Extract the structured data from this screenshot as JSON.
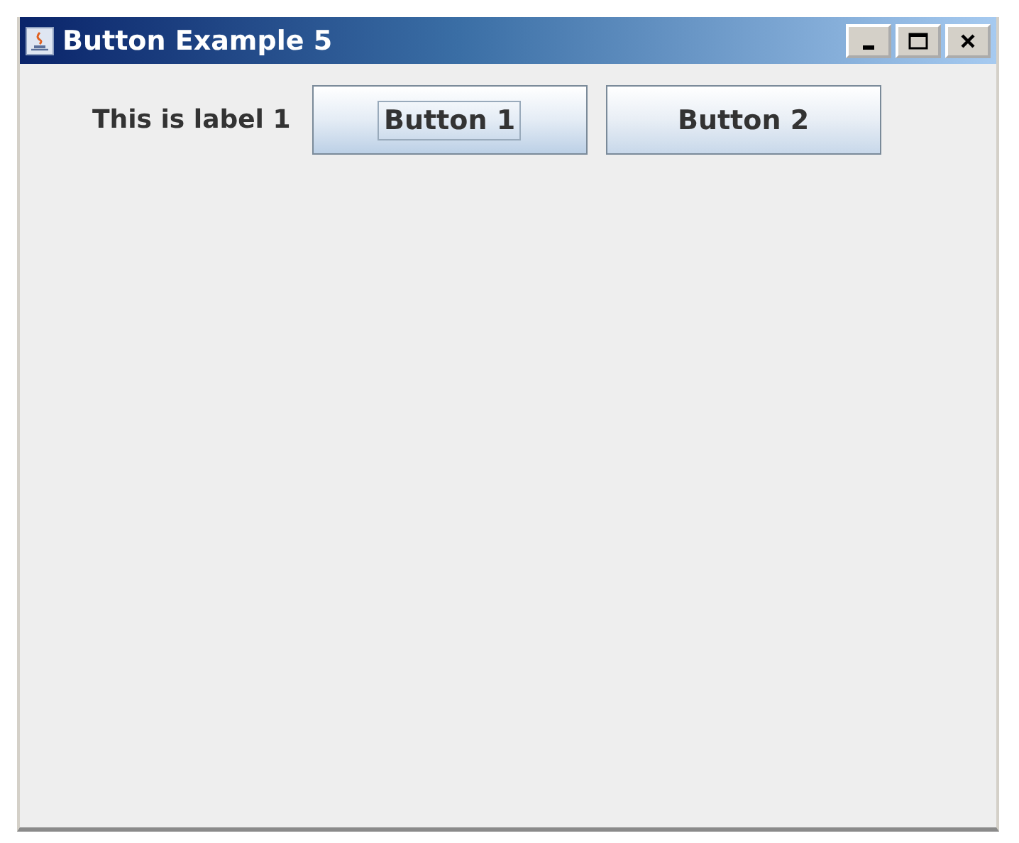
{
  "window": {
    "title": "Button Example 5"
  },
  "label": "This is label 1",
  "buttons": [
    {
      "label": "Button 1",
      "focused": true
    },
    {
      "label": "Button 2",
      "focused": false
    }
  ]
}
